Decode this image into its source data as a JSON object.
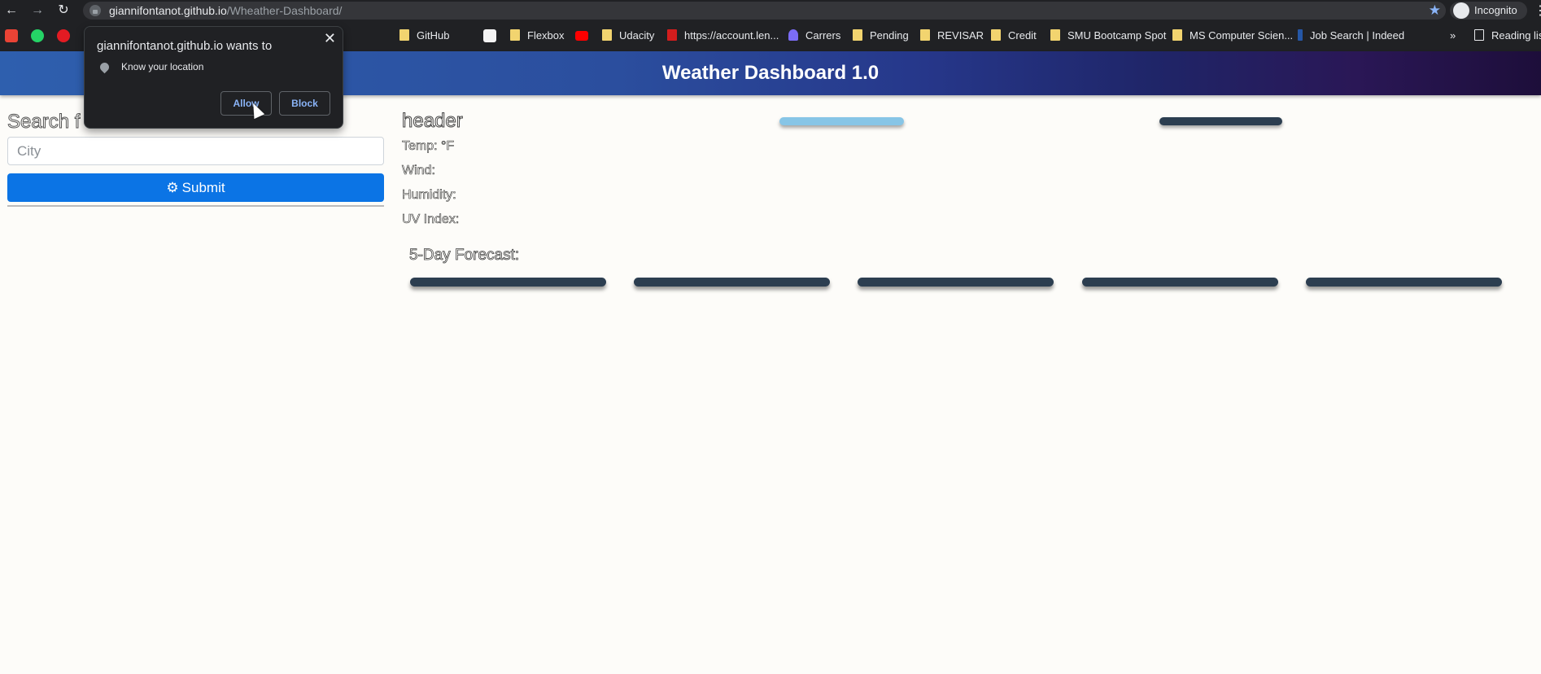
{
  "browser": {
    "url_host": "giannifontanot.github.io",
    "url_path": "/Wheather-Dashboard/",
    "profile_label": "Incognito",
    "nav_icons": [
      "back-icon",
      "forward-icon",
      "reload-icon"
    ],
    "bookmarks": [
      {
        "label": "GitHub",
        "icon": "folder-icon"
      },
      {
        "label": "Flexbox",
        "icon": "folder-icon"
      },
      {
        "label": "Udacity",
        "icon": "folder-icon"
      },
      {
        "label": "https://account.len...",
        "icon": "l-icon"
      },
      {
        "label": "Carrers",
        "icon": "triangle-icon"
      },
      {
        "label": "Pending",
        "icon": "folder-icon"
      },
      {
        "label": "REVISAR",
        "icon": "folder-icon"
      },
      {
        "label": "Credit",
        "icon": "folder-icon"
      },
      {
        "label": "SMU Bootcamp Spot",
        "icon": "folder-icon"
      },
      {
        "label": "MS Computer Scien...",
        "icon": "folder-icon"
      },
      {
        "label": "Job Search | Indeed",
        "icon": "indeed-icon"
      },
      {
        "label": "Reading lis",
        "icon": "reading-list-icon"
      }
    ],
    "overflow_glyph": "»"
  },
  "page": {
    "title": "Weather Dashboard 1.0",
    "search": {
      "heading": "Search f",
      "placeholder": "City",
      "submit_label": "Submit"
    },
    "current": {
      "header": "header",
      "temp_label": "Temp: °F",
      "wind_label": "Wind:",
      "humidity_label": "Humidity:",
      "uv_label": "UV Index:"
    },
    "forecast": {
      "title": "5-Day Forecast:",
      "card_count": 5
    }
  },
  "permission_popup": {
    "title": "giannifontanot.github.io wants to",
    "permission": "Know your location",
    "allow_label": "Allow",
    "block_label": "Block",
    "close_glyph": "✕"
  },
  "colors": {
    "primary_button": "#0b74e5",
    "accent_pill": "#87c5e6",
    "dark_card": "#2c3e50"
  }
}
